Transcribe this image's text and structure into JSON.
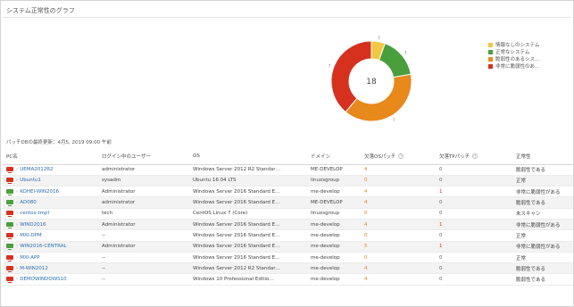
{
  "page": {
    "title": "システム正常性のグラフ",
    "updated_label": "パッチDBの最終更新：4月5, 2019 09:00 午前"
  },
  "chart_data": {
    "type": "pie",
    "center_label": "18",
    "categories": [
      "情報なしのシステム",
      "正常なシステム",
      "脆弱性のあるシス…",
      "非常に脆弱性のあ…"
    ],
    "values": [
      1,
      3,
      7,
      7
    ],
    "colors": [
      "#f2c744",
      "#4a9e3c",
      "#e8891c",
      "#d6311f"
    ],
    "slice_labels": [
      "1",
      "3",
      "7",
      "7"
    ]
  },
  "legend": [
    {
      "label": "情報なしのシステム",
      "color": "#f2c744"
    },
    {
      "label": "正常なシステム",
      "color": "#4a9e3c"
    },
    {
      "label": "脆弱性のあるシス…",
      "color": "#e8891c"
    },
    {
      "label": "非常に脆弱性のあ…",
      "color": "#d6311f"
    }
  ],
  "table": {
    "headers": [
      "PC名",
      "ログイン中のユーザー",
      "OS",
      "ドメイン",
      "欠落OSパッチ",
      "欠落TPパッチ",
      "正常性"
    ],
    "rows": [
      {
        "pc": "UEMA2012R2",
        "user": "administrator",
        "os": "Windows Server 2012 R2 Standar…",
        "domain": "ME-DEVELOP",
        "os_patch": "4",
        "tp_patch": "0",
        "health": "脆弱性である",
        "icon": "#d6311f",
        "os_color": "orange",
        "tp_color": "gray"
      },
      {
        "pc": "Ubuntu1",
        "user": "sysadm",
        "os": "Ubuntu 16.04 LTS",
        "domain": "linuxsgroup",
        "os_patch": "0",
        "tp_patch": "0",
        "health": "正常",
        "icon": "#d6311f",
        "os_color": "orange",
        "tp_color": "gray"
      },
      {
        "pc": "KOHEI-WIN2016",
        "user": "Administrator",
        "os": "Windows Server 2016 Standard E…",
        "domain": "me-develop",
        "os_patch": "4",
        "tp_patch": "1",
        "health": "非常に脆弱性がある",
        "icon": "#4a9e3c",
        "os_color": "orange",
        "tp_color": "red"
      },
      {
        "pc": "AD080",
        "user": "administrator",
        "os": "Windows Server 2016 Standard E…",
        "domain": "ME-DEVELOP",
        "os_patch": "4",
        "tp_patch": "0",
        "health": "脆弱性である",
        "icon": "#4a9e3c",
        "os_color": "orange",
        "tp_color": "gray"
      },
      {
        "pc": "centos-tmpl",
        "user": "tech",
        "os": "CentOS Linux 7 (Core)",
        "domain": "linuxsgroup",
        "os_patch": "0",
        "tp_patch": "0",
        "health": "未スキャン",
        "icon": "#d6311f",
        "os_color": "orange",
        "tp_color": "gray"
      },
      {
        "pc": "WIND2016",
        "user": "Administrator",
        "os": "Windows Server 2016 Standard E…",
        "domain": "me-develop",
        "os_patch": "4",
        "tp_patch": "1",
        "health": "非常に脆弱性がある",
        "icon": "#4a9e3c",
        "os_color": "orange",
        "tp_color": "red"
      },
      {
        "pc": "MXI-DPM",
        "user": "--",
        "os": "Windows Server 2016 Standard E…",
        "domain": "me-develop",
        "os_patch": "0",
        "tp_patch": "0",
        "health": "正常",
        "icon": "#d6311f",
        "os_color": "orange",
        "tp_color": "gray"
      },
      {
        "pc": "WIN2016-CENTRAL",
        "user": "Administrator",
        "os": "Windows Server 2016 Standard E…",
        "domain": "me-develop",
        "os_patch": "5",
        "tp_patch": "1",
        "health": "非常に脆弱性がある",
        "icon": "#4a9e3c",
        "os_color": "orange",
        "tp_color": "red"
      },
      {
        "pc": "MXI-APP",
        "user": "--",
        "os": "Windows Server 2016 Standard E…",
        "domain": "me-develop",
        "os_patch": "0",
        "tp_patch": "0",
        "health": "正常",
        "icon": "#d6311f",
        "os_color": "orange",
        "tp_color": "gray"
      },
      {
        "pc": "M-WIN2012",
        "user": "--",
        "os": "Windows Server 2012 R2 Standar…",
        "domain": "me-develop",
        "os_patch": "4",
        "tp_patch": "0",
        "health": "脆弱性である",
        "icon": "#d6311f",
        "os_color": "orange",
        "tp_color": "gray"
      },
      {
        "pc": "DEMOWINDOWS10",
        "user": "--",
        "os": "Windows 10 Professional Editio…",
        "domain": "me-develop",
        "os_patch": "4",
        "tp_patch": "0",
        "health": "脆弱性である",
        "icon": "#d6311f",
        "os_color": "orange",
        "tp_color": "gray"
      }
    ]
  }
}
